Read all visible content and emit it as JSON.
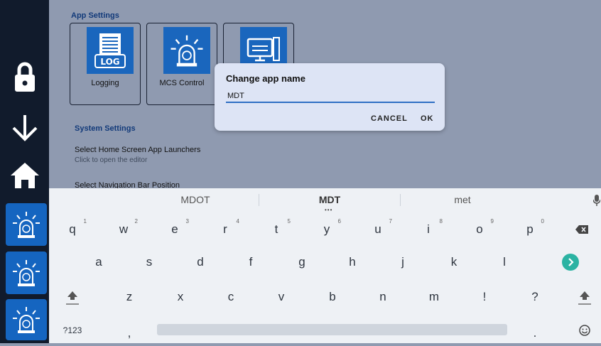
{
  "app_settings": {
    "section_label": "App Settings",
    "tiles": [
      {
        "label": "Logging",
        "icon": "log-icon"
      },
      {
        "label": "MCS Control",
        "icon": "siren-icon"
      },
      {
        "label": "",
        "icon": "computer-icon"
      }
    ]
  },
  "system_settings": {
    "section_label": "System Settings",
    "items": [
      {
        "title": "Select Home Screen App Launchers",
        "subtitle": "Click to open the editor"
      },
      {
        "title": "Select Navigation Bar Position"
      }
    ]
  },
  "sidebar": {
    "icons": [
      "lock-icon",
      "arrow-down-icon",
      "home-icon",
      "siren-icon",
      "siren-icon",
      "siren-icon"
    ]
  },
  "dialog": {
    "title": "Change app name",
    "input_value": "MDT",
    "cancel_label": "CANCEL",
    "ok_label": "OK"
  },
  "keyboard": {
    "suggestions": [
      "MDOT",
      "MDT",
      "met"
    ],
    "row1": [
      [
        "q",
        "1"
      ],
      [
        "w",
        "2"
      ],
      [
        "e",
        "3"
      ],
      [
        "r",
        "4"
      ],
      [
        "t",
        "5"
      ],
      [
        "y",
        "6"
      ],
      [
        "u",
        "7"
      ],
      [
        "i",
        "8"
      ],
      [
        "o",
        "9"
      ],
      [
        "p",
        "0"
      ]
    ],
    "row2": [
      "a",
      "s",
      "d",
      "f",
      "g",
      "h",
      "j",
      "k",
      "l"
    ],
    "row3": [
      "z",
      "x",
      "c",
      "v",
      "b",
      "n",
      "m",
      "!",
      "?"
    ],
    "symbols_label": "?123",
    "comma": ",",
    "period": "."
  },
  "colors": {
    "accent": "#1565c0",
    "sidebar": "#111b2c",
    "dialog": "#dde4f5",
    "enter": "#2bb3a3"
  }
}
